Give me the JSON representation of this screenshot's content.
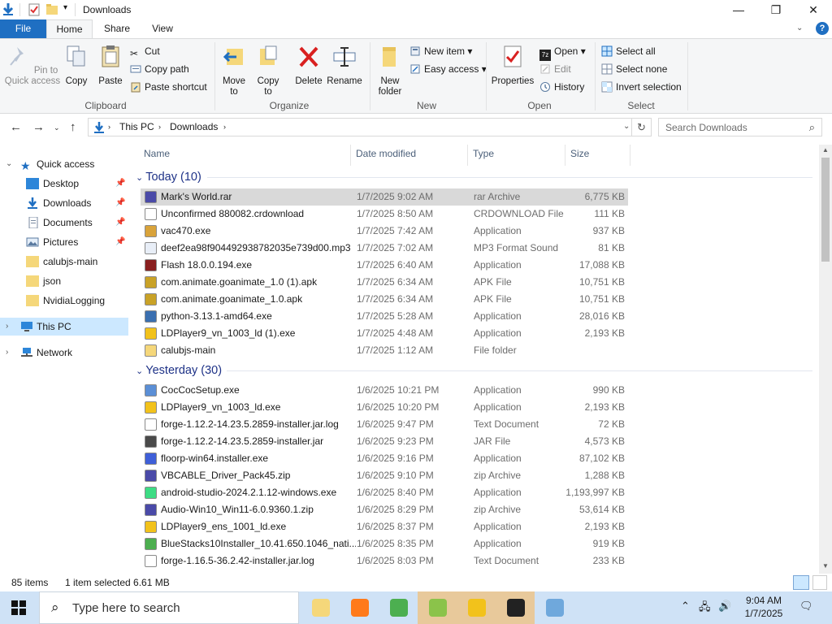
{
  "window": {
    "title": "Downloads",
    "controls": {
      "minimize": "—",
      "maximize": "❐",
      "close": "✕"
    }
  },
  "ribbon_tabs": [
    "File",
    "Home",
    "Share",
    "View"
  ],
  "ribbon": {
    "clipboard": {
      "label": "Clipboard",
      "pin": "Pin to Quick access",
      "copy": "Copy",
      "paste": "Paste",
      "cut": "Cut",
      "copy_path": "Copy path",
      "paste_shortcut": "Paste shortcut"
    },
    "organize": {
      "label": "Organize",
      "move_to": "Move to",
      "copy_to": "Copy to",
      "delete": "Delete",
      "rename": "Rename"
    },
    "new": {
      "label": "New",
      "new_folder": "New folder",
      "new_item": "New item",
      "easy_access": "Easy access"
    },
    "open": {
      "label": "Open",
      "properties": "Properties",
      "open": "Open",
      "edit": "Edit",
      "history": "History"
    },
    "select": {
      "label": "Select",
      "select_all": "Select all",
      "select_none": "Select none",
      "invert": "Invert selection"
    }
  },
  "address": {
    "crumbs": [
      "This PC",
      "Downloads"
    ],
    "search_placeholder": "Search Downloads"
  },
  "nav": {
    "quick_access": "Quick access",
    "items": [
      "Desktop",
      "Downloads",
      "Documents",
      "Pictures",
      "calubjs-main",
      "json",
      "NvidiaLogging"
    ],
    "this_pc": "This PC",
    "network": "Network"
  },
  "columns": [
    "Name",
    "Date modified",
    "Type",
    "Size"
  ],
  "groups": [
    {
      "title": "Today (10)",
      "files": [
        {
          "name": "Mark's World.rar",
          "date": "1/7/2025 9:02 AM",
          "type": "rar Archive",
          "size": "6,775 KB",
          "icon": "rar-archive-icon",
          "color": "#4a4aa8",
          "selected": true
        },
        {
          "name": "Unconfirmed 880082.crdownload",
          "date": "1/7/2025 8:50 AM",
          "type": "CRDOWNLOAD File",
          "size": "111 KB",
          "icon": "blank-file-icon",
          "color": "#ffffff"
        },
        {
          "name": "vac470.exe",
          "date": "1/7/2025 7:42 AM",
          "type": "Application",
          "size": "937 KB",
          "icon": "vac-installer-icon",
          "color": "#d9a33a"
        },
        {
          "name": "deef2ea98f904492938782035e739d00.mp3",
          "date": "1/7/2025 7:02 AM",
          "type": "MP3 Format Sound",
          "size": "81 KB",
          "icon": "audio-file-icon",
          "color": "#e8eef7"
        },
        {
          "name": "Flash 18.0.0.194.exe",
          "date": "1/7/2025 6:40 AM",
          "type": "Application",
          "size": "17,088 KB",
          "icon": "flash-icon",
          "color": "#8a1f1f"
        },
        {
          "name": "com.animate.goanimate_1.0 (1).apk",
          "date": "1/7/2025 6:34 AM",
          "type": "APK File",
          "size": "10,751 KB",
          "icon": "apk-file-icon",
          "color": "#c9a227"
        },
        {
          "name": "com.animate.goanimate_1.0.apk",
          "date": "1/7/2025 6:34 AM",
          "type": "APK File",
          "size": "10,751 KB",
          "icon": "apk-file-icon",
          "color": "#c9a227"
        },
        {
          "name": "python-3.13.1-amd64.exe",
          "date": "1/7/2025 5:28 AM",
          "type": "Application",
          "size": "28,016 KB",
          "icon": "python-icon",
          "color": "#3a6fb0"
        },
        {
          "name": "LDPlayer9_vn_1003_ld (1).exe",
          "date": "1/7/2025 4:48 AM",
          "type": "Application",
          "size": "2,193 KB",
          "icon": "ldplayer-icon",
          "color": "#f2c21b"
        },
        {
          "name": "calubjs-main",
          "date": "1/7/2025 1:12 AM",
          "type": "File folder",
          "size": "",
          "icon": "folder-icon",
          "color": "#f5d77a"
        }
      ]
    },
    {
      "title": "Yesterday (30)",
      "files": [
        {
          "name": "CocCocSetup.exe",
          "date": "1/6/2025 10:21 PM",
          "type": "Application",
          "size": "990 KB",
          "icon": "coccoc-icon",
          "color": "#5b8fd6"
        },
        {
          "name": "LDPlayer9_vn_1003_ld.exe",
          "date": "1/6/2025 10:20 PM",
          "type": "Application",
          "size": "2,193 KB",
          "icon": "ldplayer-icon",
          "color": "#f2c21b"
        },
        {
          "name": "forge-1.12.2-14.23.5.2859-installer.jar.log",
          "date": "1/6/2025 9:47 PM",
          "type": "Text Document",
          "size": "72 KB",
          "icon": "text-file-icon",
          "color": "#ffffff"
        },
        {
          "name": "forge-1.12.2-14.23.5.2859-installer.jar",
          "date": "1/6/2025 9:23 PM",
          "type": "JAR File",
          "size": "4,573 KB",
          "icon": "jar-file-icon",
          "color": "#4a4a4a"
        },
        {
          "name": "floorp-win64.installer.exe",
          "date": "1/6/2025 9:16 PM",
          "type": "Application",
          "size": "87,102 KB",
          "icon": "floorp-icon",
          "color": "#3f5fd8"
        },
        {
          "name": "VBCABLE_Driver_Pack45.zip",
          "date": "1/6/2025 9:10 PM",
          "type": "zip Archive",
          "size": "1,288 KB",
          "icon": "zip-archive-icon",
          "color": "#4a4aa8"
        },
        {
          "name": "android-studio-2024.2.1.12-windows.exe",
          "date": "1/6/2025 8:40 PM",
          "type": "Application",
          "size": "1,193,997 KB",
          "icon": "android-studio-icon",
          "color": "#3ddc84"
        },
        {
          "name": "Audio-Win10_Win11-6.0.9360.1.zip",
          "date": "1/6/2025 8:29 PM",
          "type": "zip Archive",
          "size": "53,614 KB",
          "icon": "zip-archive-icon",
          "color": "#4a4aa8"
        },
        {
          "name": "LDPlayer9_ens_1001_ld.exe",
          "date": "1/6/2025 8:37 PM",
          "type": "Application",
          "size": "2,193 KB",
          "icon": "ldplayer-icon",
          "color": "#f2c21b"
        },
        {
          "name": "BlueStacks10Installer_10.41.650.1046_nati...",
          "date": "1/6/2025 8:35 PM",
          "type": "Application",
          "size": "919 KB",
          "icon": "bluestacks-icon",
          "color": "#4cae4f"
        },
        {
          "name": "forge-1.16.5-36.2.42-installer.jar.log",
          "date": "1/6/2025 8:03 PM",
          "type": "Text Document",
          "size": "233 KB",
          "icon": "text-file-icon",
          "color": "#ffffff"
        }
      ]
    }
  ],
  "status": {
    "items": "85 items",
    "selected": "1 item selected  6.61 MB"
  },
  "taskbar": {
    "search_placeholder": "Type here to search",
    "apps": [
      "file-explorer-icon",
      "firefox-icon",
      "chrome-icon",
      "coccoc-icon",
      "ldplayer-icon",
      "7zip-icon",
      "installer-icon"
    ],
    "time": "9:04 AM",
    "date": "1/7/2025"
  },
  "colors": {
    "accent": "#1f6fc2",
    "selection": "#cce8ff",
    "taskbar": "#cfe2f6"
  }
}
